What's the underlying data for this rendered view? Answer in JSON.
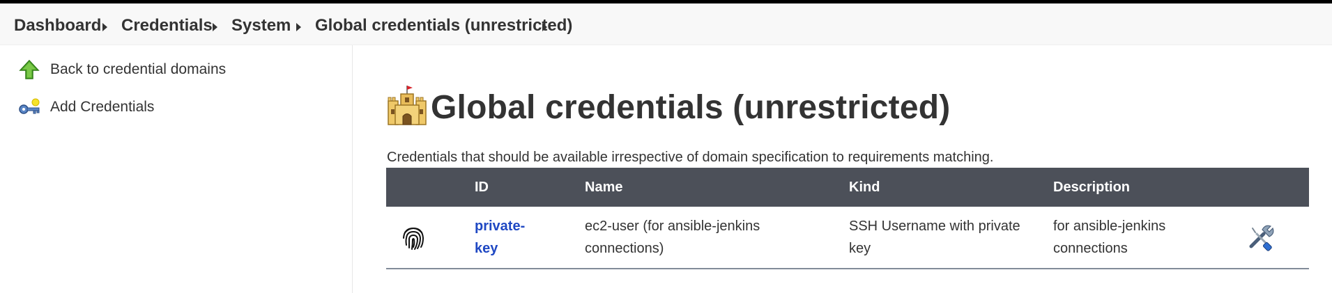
{
  "breadcrumbs": [
    {
      "label": "Dashboard"
    },
    {
      "label": "Credentials"
    },
    {
      "label": "System"
    },
    {
      "label": "Global credentials (unrestricted)"
    }
  ],
  "sidebar": {
    "items": [
      {
        "label": "Back to credential domains",
        "icon": "up-arrow-icon"
      },
      {
        "label": "Add Credentials",
        "icon": "key-icon"
      }
    ]
  },
  "main": {
    "title": "Global credentials (unrestricted)",
    "title_icon": "castle-icon",
    "description": "Credentials that should be available irrespective of domain specification to requirements matching.",
    "table": {
      "headers": [
        "",
        "ID",
        "Name",
        "Kind",
        "Description",
        ""
      ],
      "rows": [
        {
          "icon": "fingerprint-icon",
          "id_line1": "private-",
          "id_line2": "key",
          "name_line1": "ec2-user (for ansible-jenkins",
          "name_line2": "connections)",
          "kind_line1": "SSH Username with private",
          "kind_line2": "key",
          "description_line1": "for ansible-jenkins",
          "description_line2": "connections",
          "action_icon": "wrench-screwdriver-icon"
        }
      ]
    }
  },
  "colors": {
    "header_bg": "#4c5059",
    "link": "#1f48c3",
    "breadcrumb_bg": "#f8f8f8"
  }
}
